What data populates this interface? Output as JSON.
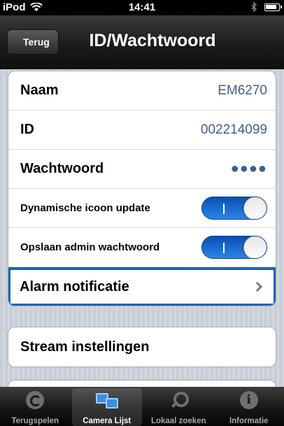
{
  "status": {
    "carrier": "iPod",
    "time": "14:41"
  },
  "nav": {
    "back_label": "Terug",
    "title": "ID/Wachtwoord"
  },
  "settings": {
    "name_label": "Naam",
    "name_value": "EM6270",
    "id_label": "ID",
    "id_value": "002214099",
    "password_label": "Wachtwoord",
    "password_value": "●●●●",
    "dynamic_icon_label": "Dynamische icoon update",
    "dynamic_icon_on": true,
    "save_admin_label": "Opslaan admin wachtwoord",
    "save_admin_on": true,
    "alarm_label": "Alarm notificatie",
    "stream_label": "Stream instellingen"
  },
  "tabs": [
    {
      "label": "Terugspelen",
      "icon": "replay-icon",
      "active": false
    },
    {
      "label": "Camera Lijst",
      "icon": "camera-list-icon",
      "active": true
    },
    {
      "label": "Lokaal zoeken",
      "icon": "search-icon",
      "active": false
    },
    {
      "label": "Informatie",
      "icon": "info-icon",
      "active": false
    }
  ],
  "colors": {
    "accent": "#1466b8",
    "value_text": "#3e5f92",
    "toggle_on": "#2b85e8"
  }
}
